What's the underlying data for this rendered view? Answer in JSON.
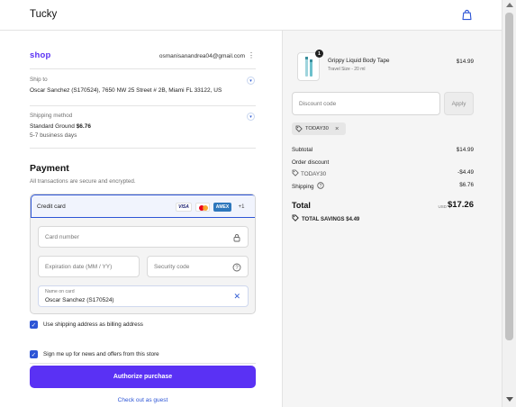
{
  "header": {
    "store_name": "Tucky",
    "cart_icon": "shopping-bag-icon"
  },
  "shop": {
    "logo": "shop",
    "email": "osmanisanandrea04@gmail.com"
  },
  "ship_to": {
    "label": "Ship to",
    "value": "Oscar Sanchez (S170524), 7650 NW 25 Street # 2B, Miami FL 33122, US"
  },
  "shipping_method": {
    "label": "Shipping method",
    "name": "Standard Ground",
    "price": "$6.76",
    "eta": "5-7 business days"
  },
  "payment": {
    "title": "Payment",
    "subtitle": "All transactions are secure and encrypted.",
    "method_label": "Credit card",
    "brands": [
      "VISA",
      "AMEX",
      "+1"
    ],
    "card_number_placeholder": "Card number",
    "expiration_placeholder": "Expiration date (MM / YY)",
    "security_code_placeholder": "Security code",
    "name_label": "Name on card",
    "name_value": "Oscar Sanchez (S170524)"
  },
  "billing_checkbox": {
    "checked": true,
    "label": "Use shipping address as billing address"
  },
  "newsletter_checkbox": {
    "checked": true,
    "label": "Sign me up for news and offers from this store"
  },
  "authorize_label": "Authorize purchase",
  "guest_link": "Check out as guest",
  "order": {
    "product": {
      "name": "Grippy Liquid Body Tape",
      "variant": "Travel Size - 20 ml",
      "price": "$14.99",
      "quantity": "1"
    },
    "discount_placeholder": "Discount code",
    "apply_label": "Apply",
    "applied_code": "TODAY30",
    "subtotal_label": "Subtotal",
    "subtotal_value": "$14.99",
    "order_discount_label": "Order discount",
    "discount_code": "TODAY30",
    "discount_value": "-$4.49",
    "shipping_label": "Shipping",
    "shipping_value": "$6.76",
    "total_label": "Total",
    "currency": "USD",
    "total_value": "$17.26",
    "savings_label": "TOTAL SAVINGS",
    "savings_value": "$4.49"
  },
  "colors": {
    "accent": "#5a31f4",
    "link": "#2d55d6"
  }
}
